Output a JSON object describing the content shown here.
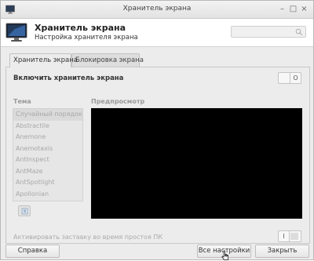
{
  "window": {
    "title": "Хранитель экрана"
  },
  "header": {
    "title": "Хранитель экрана",
    "subtitle": "Настройка хранителя экрана",
    "search_placeholder": ""
  },
  "tabs": [
    {
      "label": "Хранитель экрана",
      "active": true
    },
    {
      "label": "Блокировка экрана",
      "active": false
    }
  ],
  "settings": {
    "enable_label": "Включить хранитель экрана",
    "enable_toggle": "O",
    "theme_label": "Тема",
    "preview_label": "Предпросмотр",
    "idle_label": "Активировать заставку во время простоя ПК",
    "idle_toggle": "I"
  },
  "themes": [
    "Случайный порядок",
    "Abstractile",
    "Anemone",
    "Anemotaxis",
    "AntInspect",
    "AntMaze",
    "AntSpotlight",
    "Apollonian"
  ],
  "buttons": {
    "help": "Справка",
    "all_settings": "Все настройки",
    "close": "Закрыть"
  },
  "colors": {
    "preview_bg": "#000000",
    "accent": "#2f6fb8"
  }
}
